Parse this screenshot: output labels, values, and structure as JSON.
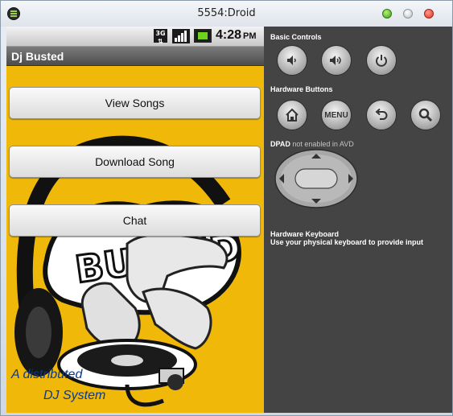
{
  "window": {
    "title": "5554:Droid",
    "controls": [
      "maximize",
      "minimize",
      "close"
    ]
  },
  "device": {
    "status_bar": {
      "network": "3G",
      "time": "4:28",
      "ampm": "PM",
      "icons": [
        "3g-icon",
        "signal-icon",
        "battery-icon"
      ]
    },
    "app_title": "Dj Busted",
    "buttons": {
      "view_songs": "View Songs",
      "download_song": "Download Song",
      "chat": "Chat"
    },
    "background": {
      "caption_line1": "A distributed",
      "caption_line2": "DJ System",
      "logo_text": "BUSTED",
      "color": "#f0b808"
    }
  },
  "panel": {
    "basic_controls": "Basic Controls",
    "hardware_buttons": "Hardware Buttons",
    "menu_label": "MENU",
    "dpad_label": "DPAD",
    "dpad_note": "not enabled in AVD",
    "keyboard_heading": "Hardware Keyboard",
    "keyboard_note": "Use your physical keyboard to provide input"
  }
}
